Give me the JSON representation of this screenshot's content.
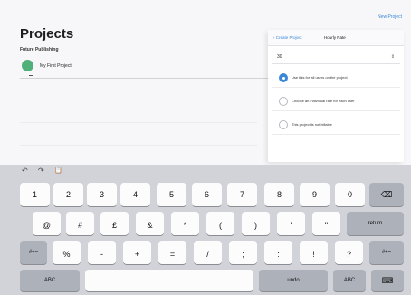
{
  "app": {
    "new_project_label": "New Project",
    "title": "Projects",
    "section_label": "Future Publishing",
    "project": {
      "name": "My First Project"
    }
  },
  "popover": {
    "back_label": "Create Project",
    "title": "Hourly Rate",
    "rate_value": "30",
    "stepper_glyph": "⇕",
    "options": [
      {
        "label": "Use this for all users on the project",
        "selected": true
      },
      {
        "label": "Choose an individual rate for each user",
        "selected": false
      },
      {
        "label": "This project is not billable",
        "selected": false
      }
    ]
  },
  "keyboard": {
    "toolbar": {
      "undo_icon": "↶",
      "redo_icon": "↷",
      "paste_icon": "📋"
    },
    "row1": [
      "1",
      "2",
      "3",
      "4",
      "5",
      "6",
      "7",
      "8",
      "9",
      "0"
    ],
    "backspace_glyph": "⌫",
    "row2": [
      {
        "main": "@",
        "hint": ""
      },
      {
        "main": "#",
        "hint": ""
      },
      {
        "main": "£",
        "hint": ""
      },
      {
        "main": "&",
        "hint": ""
      },
      {
        "main": "*",
        "hint": ""
      },
      {
        "main": "(",
        "hint": ""
      },
      {
        "main": ")",
        "hint": ""
      },
      {
        "main": "'",
        "hint": ""
      },
      {
        "main": "\"",
        "hint": ""
      }
    ],
    "return_label": "return",
    "shift_left_label": "#+=",
    "row3": [
      {
        "main": "%",
        "hint": ""
      },
      {
        "main": "-",
        "hint": ""
      },
      {
        "main": "+",
        "hint": ""
      },
      {
        "main": "=",
        "hint": ""
      },
      {
        "main": "/",
        "hint": ""
      },
      {
        "main": ";",
        "hint": ""
      },
      {
        "main": ":",
        "hint": ""
      },
      {
        "main": "!",
        "hint": ""
      },
      {
        "main": "?",
        "hint": ""
      }
    ],
    "shift_right_label": "#+=",
    "abc_left_label": "ABC",
    "undo_label": "undo",
    "abc_right_label": "ABC",
    "hide_keyboard_glyph": "⌨"
  }
}
